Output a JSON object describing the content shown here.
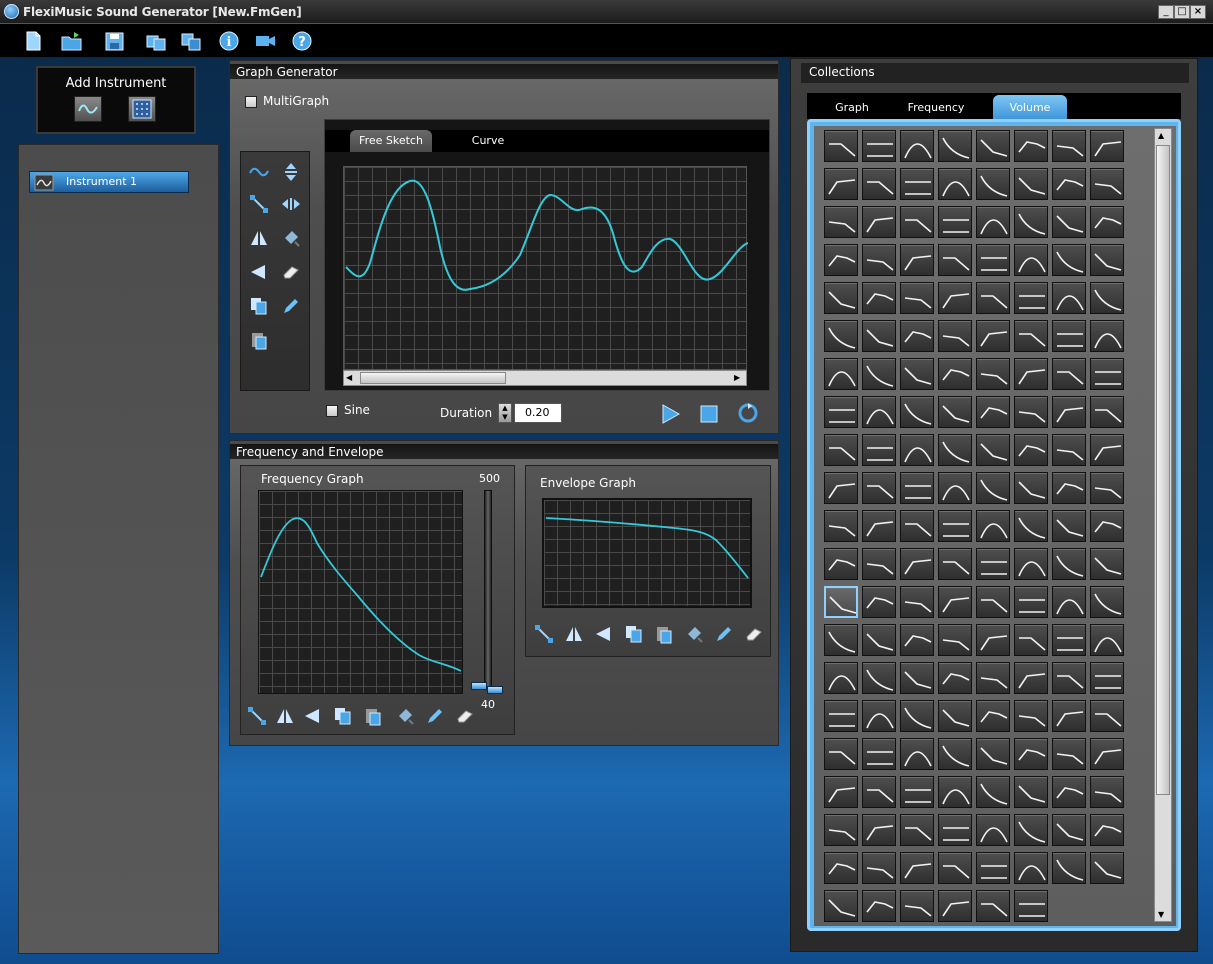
{
  "window": {
    "title": "FlexiMusic Sound Generator [New.FmGen]",
    "minimize": "_",
    "maximize": "□",
    "close": "×"
  },
  "toolbar": {
    "icons": [
      "new-file-icon",
      "open-folder-icon",
      "save-icon",
      "save-as-icon",
      "export-icon",
      "info-icon",
      "video-icon",
      "help-icon"
    ]
  },
  "add_instrument": {
    "label": "Add Instrument"
  },
  "instruments": [
    {
      "label": "Instrument  1"
    }
  ],
  "graph_generator": {
    "header": "Graph Generator",
    "multigraph_label": "MultiGraph",
    "tabs": [
      "Free Sketch",
      "Curve"
    ],
    "active_tab": "Free Sketch",
    "sine_label": "Sine",
    "duration_label": "Duration",
    "duration_value": "0.20"
  },
  "freq_env": {
    "header": "Frequency and Envelope",
    "frequency_graph_label": "Frequency Graph",
    "slider_max": "500",
    "slider_min": "40",
    "envelope_graph_label": "Envelope Graph"
  },
  "collections": {
    "header": "Collections",
    "tabs": [
      "Graph",
      "Frequency",
      "Volume"
    ],
    "active_tab": "Volume"
  },
  "colors": {
    "accent": "#35c9d8",
    "selected_blue": "#4aa6e6",
    "background_blue": "#0c3a66"
  }
}
